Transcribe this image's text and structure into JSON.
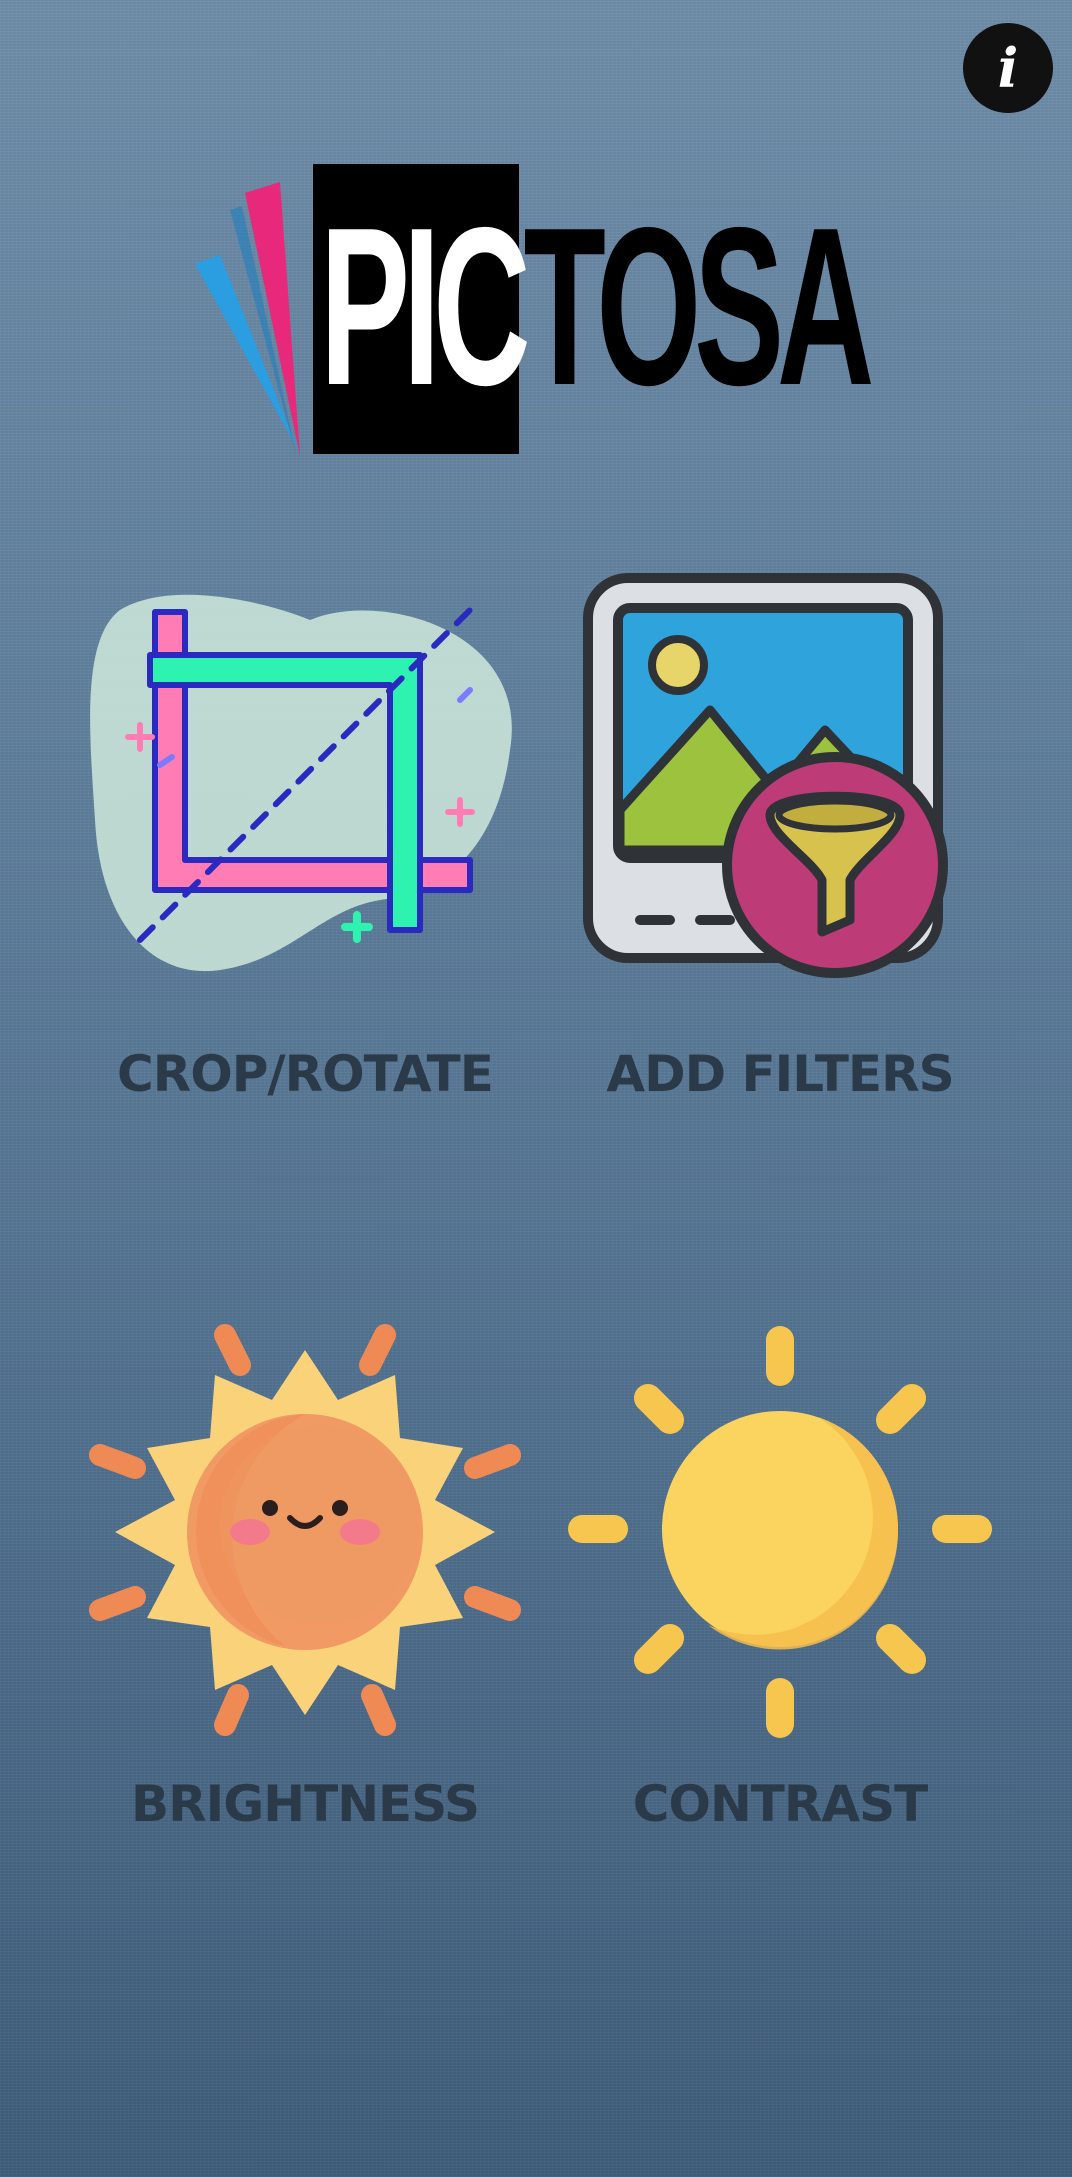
{
  "app": {
    "logo_text_inbox": "PIC",
    "logo_text_outbox": "TOSA",
    "info_icon": "info-icon",
    "info_glyph": "i"
  },
  "tools": [
    {
      "id": "crop",
      "label": "CROP/ROTATE",
      "icon": "crop-icon"
    },
    {
      "id": "filters",
      "label": "ADD FILTERS",
      "icon": "image-filter-icon"
    },
    {
      "id": "brightness",
      "label": "BRIGHTNESS",
      "icon": "smiling-sun-icon"
    },
    {
      "id": "contrast",
      "label": "CONTRAST",
      "icon": "sun-icon"
    }
  ],
  "colors": {
    "background_top": "#6f8ea9",
    "background_bottom": "#3f5d7a",
    "label_text": "#2b3a49",
    "logo_pink": "#e8287a",
    "logo_blue": "#2a9ee0"
  }
}
